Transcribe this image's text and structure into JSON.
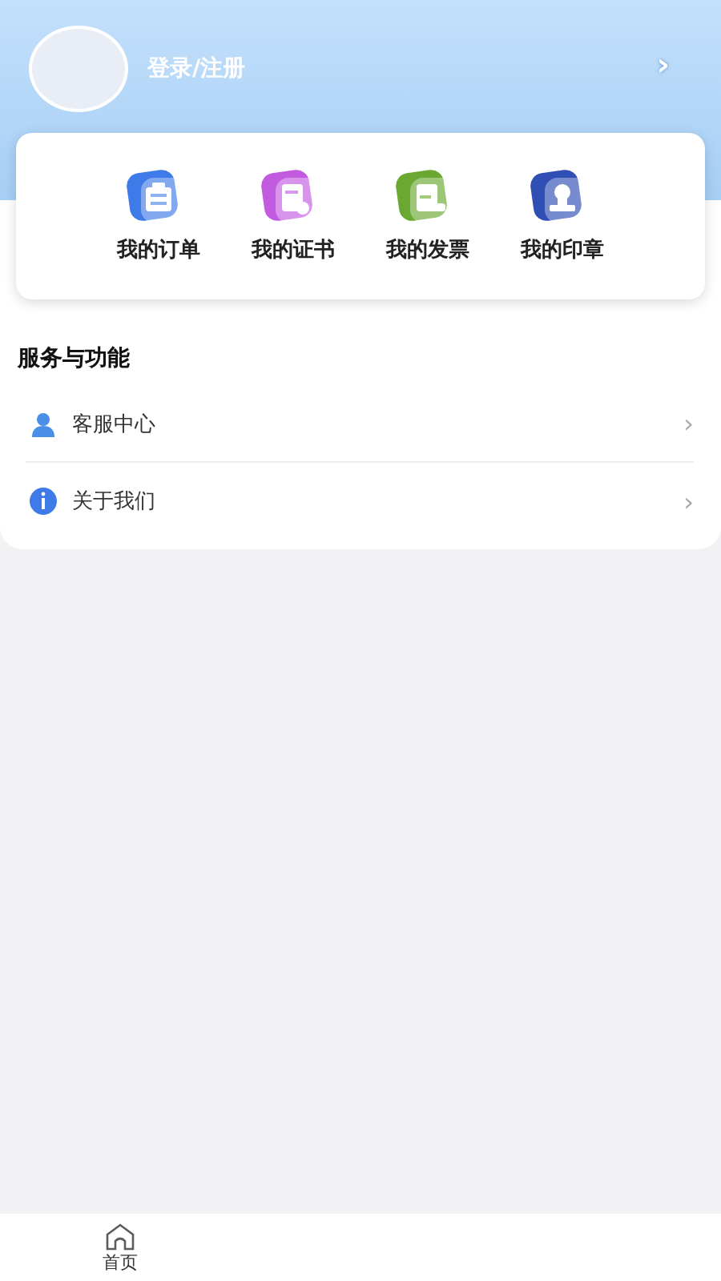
{
  "profile": {
    "login_label": "登录/注册",
    "chevron": "›"
  },
  "shortcuts": [
    {
      "label": "我的订单",
      "color": "#3f7be8",
      "kind": "clipboard"
    },
    {
      "label": "我的证书",
      "color": "#c35be0",
      "kind": "certificate"
    },
    {
      "label": "我的发票",
      "color": "#6aa832",
      "kind": "invoice"
    },
    {
      "label": "我的印章",
      "color": "#2f4fb4",
      "kind": "stamp"
    }
  ],
  "services": {
    "title": "服务与功能",
    "items": [
      {
        "label": "客服中心",
        "kind": "support",
        "chevron": "›"
      },
      {
        "label": "关于我们",
        "kind": "info",
        "chevron": "›"
      }
    ]
  },
  "tab_bar": {
    "tabs": [
      {
        "label": "首页",
        "selected": false
      }
    ]
  }
}
